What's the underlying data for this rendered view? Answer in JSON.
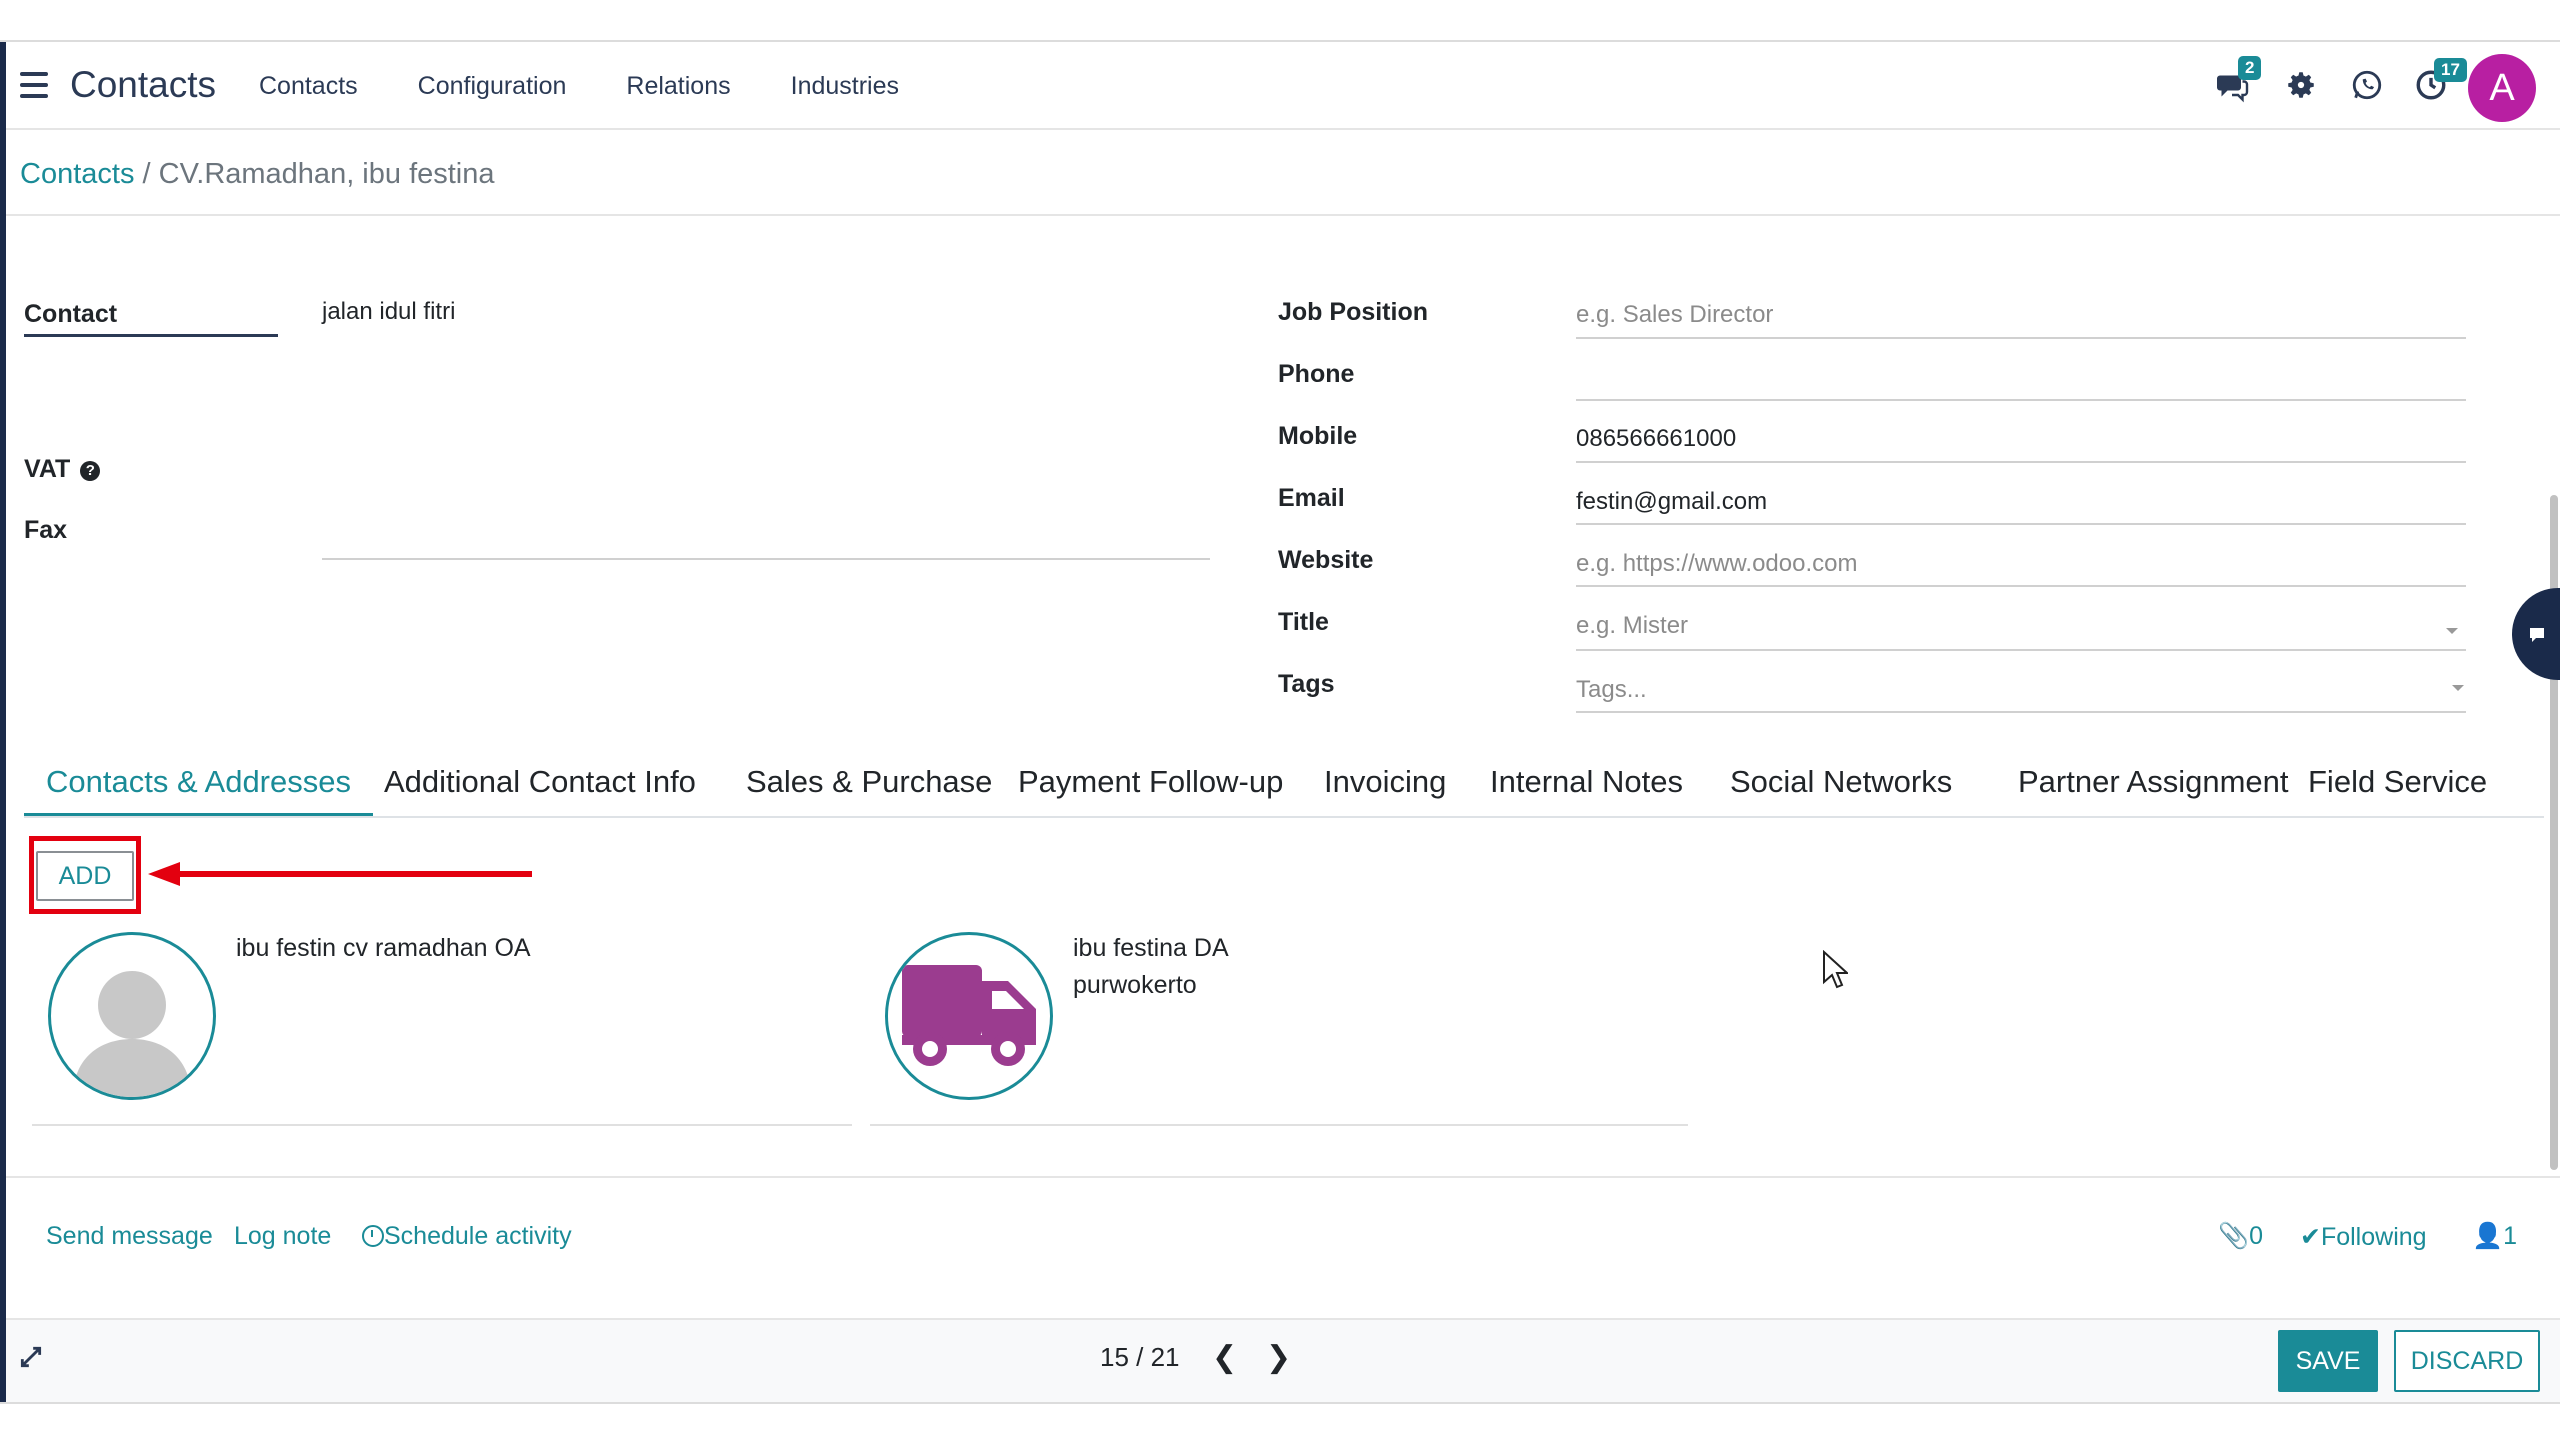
{
  "app": {
    "title": "Contacts"
  },
  "nav": {
    "menu": [
      "Contacts",
      "Configuration",
      "Relations",
      "Industries"
    ],
    "messages_badge": "2",
    "activities_badge": "17",
    "avatar_letter": "A"
  },
  "breadcrumb": {
    "parent": "Contacts",
    "separator": "/",
    "current": "CV.Ramadhan, ibu festina"
  },
  "form": {
    "left": {
      "contact_label": "Contact",
      "address_value": "jalan idul fitri",
      "vat_label": "VAT",
      "vat_help": "?",
      "fax_label": "Fax"
    },
    "right": {
      "job_position": {
        "label": "Job Position",
        "placeholder": "e.g. Sales Director"
      },
      "phone": {
        "label": "Phone",
        "value": ""
      },
      "mobile": {
        "label": "Mobile",
        "value": "086566661000"
      },
      "email": {
        "label": "Email",
        "value": "festin@gmail.com"
      },
      "website": {
        "label": "Website",
        "placeholder": "e.g. https://www.odoo.com"
      },
      "title": {
        "label": "Title",
        "placeholder": "e.g. Mister"
      },
      "tags": {
        "label": "Tags",
        "placeholder": "Tags..."
      }
    }
  },
  "tabs": [
    "Contacts & Addresses",
    "Additional Contact Info",
    "Sales & Purchase",
    "Payment Follow-up",
    "Invoicing",
    "Internal Notes",
    "Social Networks",
    "Partner Assignment",
    "Field Service"
  ],
  "active_tab": "Contacts & Addresses",
  "add_button": "ADD",
  "child_contacts": [
    {
      "name": "ibu festin cv ramadhan OA",
      "address": "",
      "icon": "person-placeholder-icon"
    },
    {
      "name": "ibu festina DA",
      "address": "purwokerto",
      "icon": "delivery-truck-icon"
    }
  ],
  "chatter": {
    "send_message": "Send message",
    "log_note": "Log note",
    "schedule_activity": "Schedule activity",
    "attachments": "0",
    "following": "Following",
    "followers": "1"
  },
  "pager": {
    "current": "15",
    "total": "21",
    "text": "15 / 21"
  },
  "buttons": {
    "save": "SAVE",
    "discard": "DISCARD"
  },
  "colors": {
    "accent": "#1a8b97",
    "annotation": "#e3000f",
    "avatar": "#b81fa2",
    "truck": "#9b3c8f"
  }
}
